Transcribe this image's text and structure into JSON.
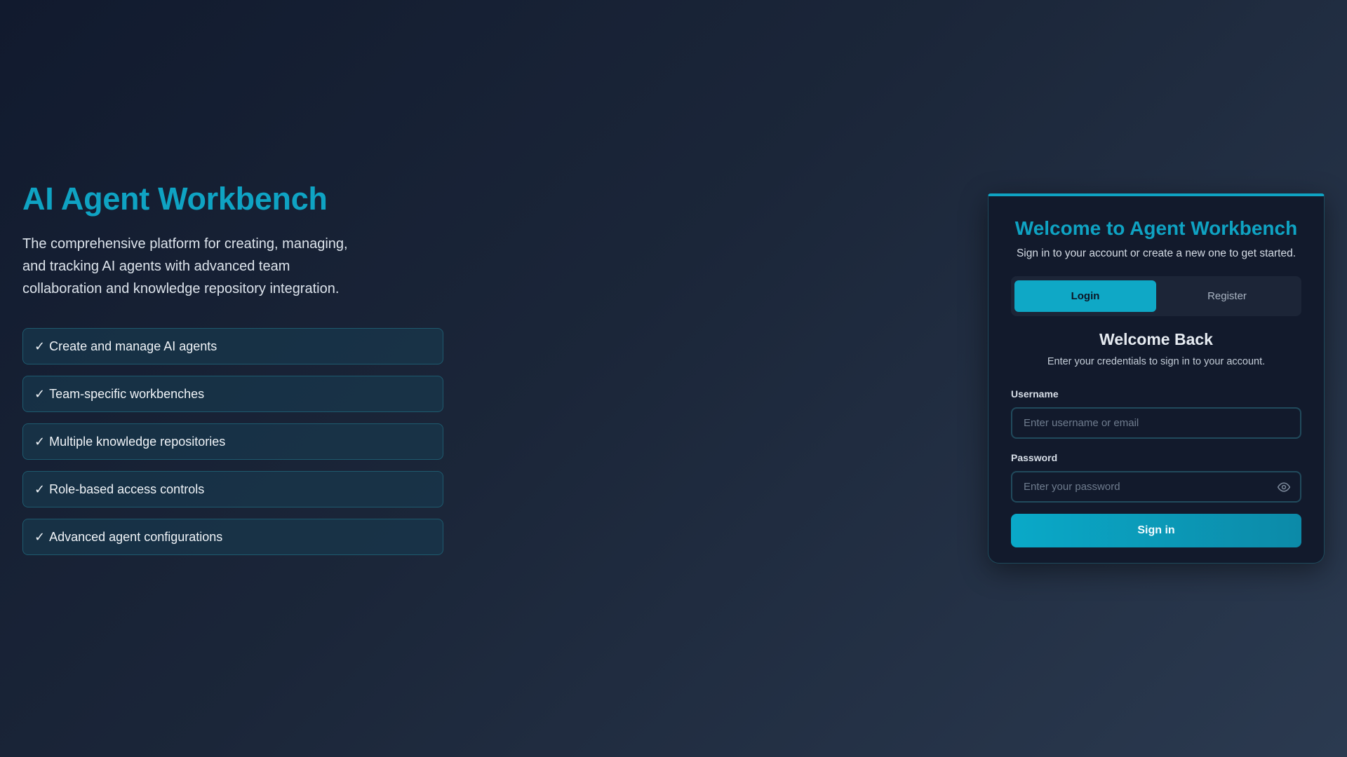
{
  "hero": {
    "title": "AI Agent Workbench",
    "description": "The comprehensive platform for creating, managing, and tracking AI agents with advanced team collaboration and knowledge repository integration.",
    "check_glyph": "✓",
    "features": [
      "Create and manage AI agents",
      "Team-specific workbenches",
      "Multiple knowledge repositories",
      "Role-based access controls",
      "Advanced agent configurations"
    ]
  },
  "card": {
    "title": "Welcome to Agent Workbench",
    "subtitle": "Sign in to your account or create a new one to get started.",
    "tabs": [
      {
        "label": "Login",
        "active": true
      },
      {
        "label": "Register",
        "active": false
      }
    ],
    "form": {
      "heading": "Welcome Back",
      "subheading": "Enter your credentials to sign in to your account.",
      "username_label": "Username",
      "username_value": "",
      "username_placeholder": "Enter username or email",
      "password_label": "Password",
      "password_value": "",
      "password_placeholder": "Enter your password",
      "password_toggle_icon": "eye-icon",
      "submit_label": "Sign in"
    }
  },
  "colors": {
    "accent": "#0fa3c3",
    "background_start": "#111a2e",
    "background_end": "#2b3a50",
    "card_background": "#121a2c"
  }
}
